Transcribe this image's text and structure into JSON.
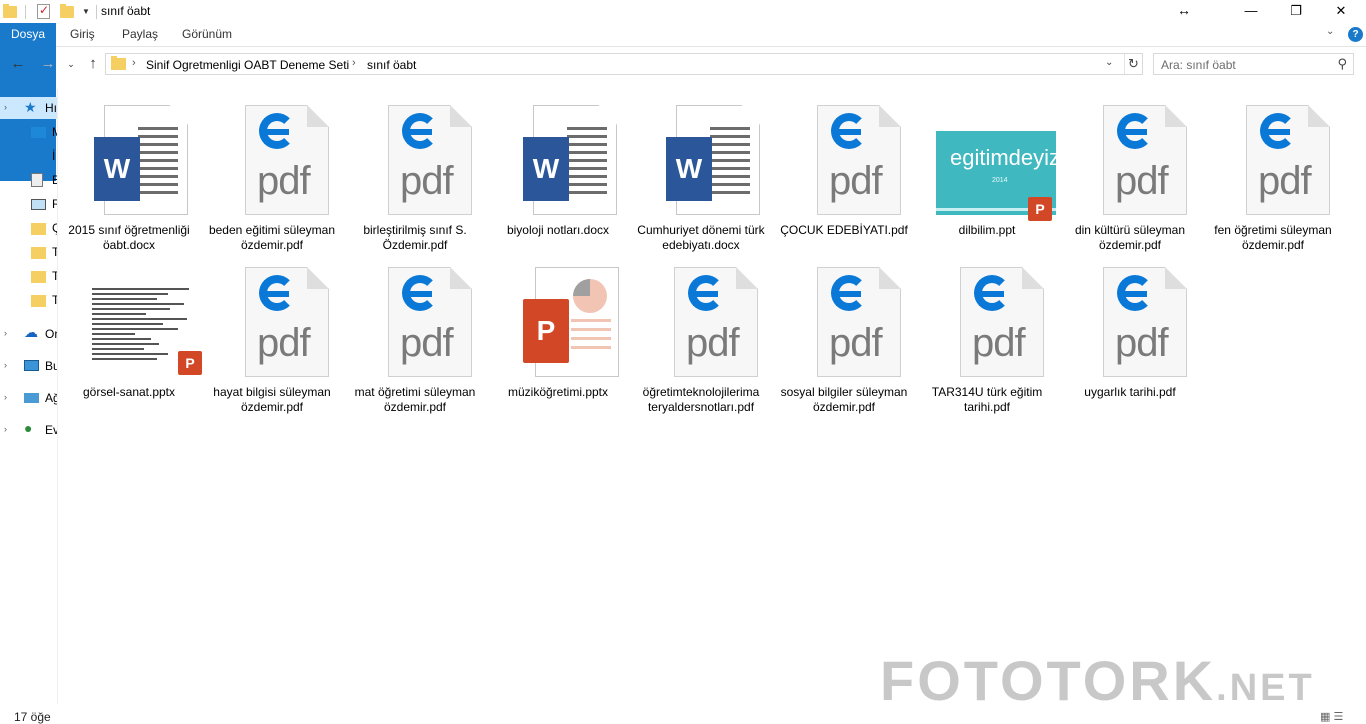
{
  "window": {
    "title": "sınıf öabt",
    "controls": {
      "resize": "↔",
      "minimize": "—",
      "maximize": "❐",
      "close": "✕"
    }
  },
  "ribbon": {
    "tabs": [
      "Dosya",
      "Giriş",
      "Paylaş",
      "Görünüm"
    ],
    "help": "?"
  },
  "address": {
    "crumbs": [
      "Sinif Ogretmenligi OABT Deneme Seti",
      "sınıf öabt"
    ],
    "search_placeholder": "Ara: sınıf öabt"
  },
  "sidebar": {
    "items": [
      {
        "label": "Hı",
        "icon": "star-icon",
        "selected": true
      },
      {
        "label": "M",
        "icon": "desktop-icon"
      },
      {
        "label": "İ",
        "icon": "download-icon"
      },
      {
        "label": "B",
        "icon": "document-icon"
      },
      {
        "label": "R",
        "icon": "picture-icon"
      },
      {
        "label": "Ç",
        "icon": "folder-icon"
      },
      {
        "label": "T",
        "icon": "folder-icon"
      },
      {
        "label": "T",
        "icon": "folder-icon"
      },
      {
        "label": "T",
        "icon": "folder-icon"
      },
      {
        "label": "Or",
        "icon": "cloud-icon"
      },
      {
        "label": "Bu",
        "icon": "computer-icon"
      },
      {
        "label": "Ağ",
        "icon": "network-icon"
      },
      {
        "label": "Ev",
        "icon": "homegroup-icon"
      }
    ]
  },
  "files": [
    {
      "name": "2015 sınıf öğretmenliği öabt.docx",
      "type": "docx",
      "icon_letter": "W"
    },
    {
      "name": "beden eğitimi süleyman özdemir.pdf",
      "type": "pdf",
      "icon_label": "pdf"
    },
    {
      "name": "birleştirilmiş sınıf S. Özdemir.pdf",
      "type": "pdf",
      "icon_label": "pdf"
    },
    {
      "name": "biyoloji notları.docx",
      "type": "docx",
      "icon_letter": "W"
    },
    {
      "name": "Cumhuriyet dönemi türk edebiyatı.docx",
      "type": "docx",
      "icon_letter": "W"
    },
    {
      "name": "ÇOCUK EDEBİYATI.pdf",
      "type": "pdf",
      "icon_label": "pdf"
    },
    {
      "name": "dilbilim.ppt",
      "type": "ppt-thumb",
      "slide_text": "egitimdeyiz",
      "slide_sub": "2014",
      "icon_letter": "P"
    },
    {
      "name": "din kültürü süleyman özdemir.pdf",
      "type": "pdf",
      "icon_label": "pdf"
    },
    {
      "name": "fen öğretimi süleyman özdemir.pdf",
      "type": "pdf",
      "icon_label": "pdf"
    },
    {
      "name": "görsel-sanat.pptx",
      "type": "pptx-preview",
      "icon_letter": "P"
    },
    {
      "name": "hayat bilgisi süleyman özdemir.pdf",
      "type": "pdf",
      "icon_label": "pdf"
    },
    {
      "name": "mat öğretimi süleyman özdemir.pdf",
      "type": "pdf",
      "icon_label": "pdf"
    },
    {
      "name": "müziköğretimi.pptx",
      "type": "pptx",
      "icon_letter": "P"
    },
    {
      "name": "öğretimteknolojilerima teryaldersnotları.pdf",
      "type": "pdf",
      "icon_label": "pdf"
    },
    {
      "name": "sosyal bilgiler süleyman özdemir.pdf",
      "type": "pdf",
      "icon_label": "pdf"
    },
    {
      "name": "TAR314U türk eğitim tarihi.pdf",
      "type": "pdf",
      "icon_label": "pdf"
    },
    {
      "name": "uygarlık tarihi.pdf",
      "type": "pdf",
      "icon_label": "pdf"
    }
  ],
  "status": {
    "count": "17 öğe"
  },
  "watermark": {
    "main": "FOTOTORK",
    "suffix": ".NET"
  }
}
